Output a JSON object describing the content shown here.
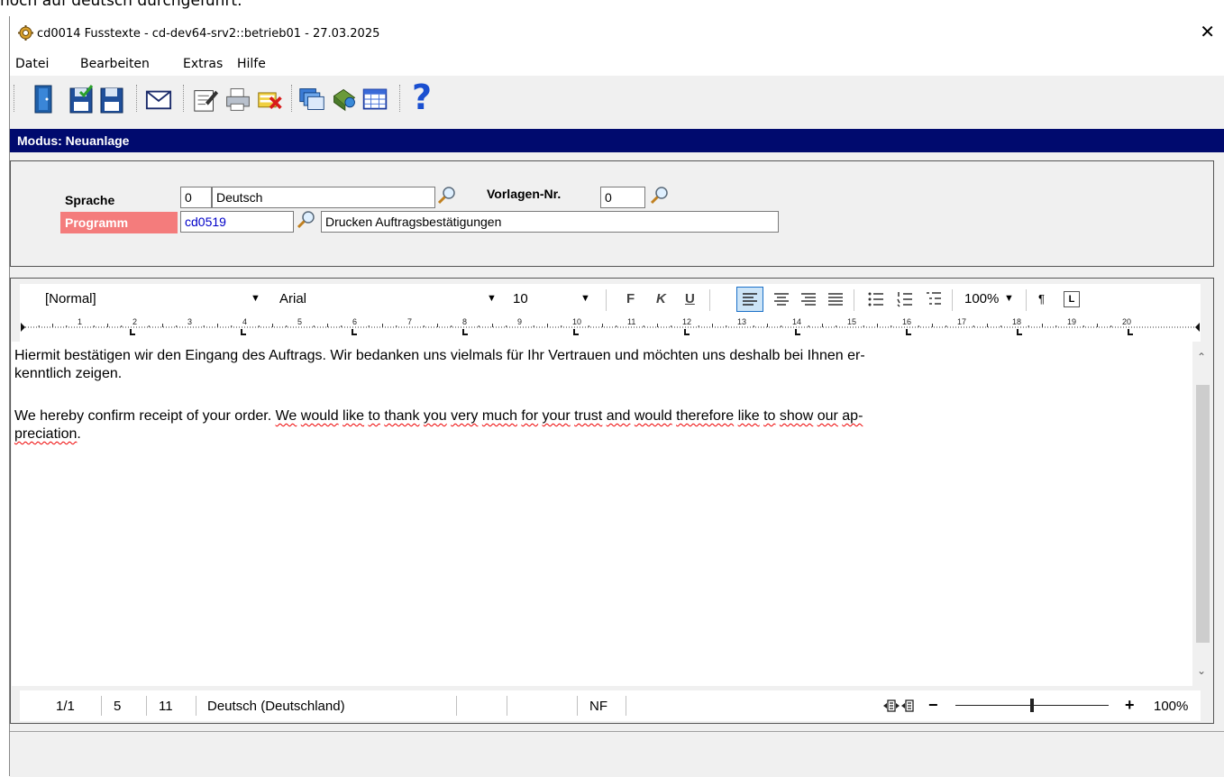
{
  "top_strip_text": "noch auf deutsch durchgeführt.",
  "window": {
    "title": "cd0014 Fusstexte - cd-dev64-srv2::betrieb01 - 27.03.2025",
    "close_symbol": "✕",
    "app_icon": "gear-icon"
  },
  "menu": [
    "Datei",
    "Bearbeiten",
    "Extras",
    "Hilfe"
  ],
  "toolbar": {
    "icons": [
      "exit-door-icon",
      "save-check-icon",
      "save-icon",
      "envelope-icon",
      "edit-form-icon",
      "printer-icon",
      "delete-red-x-icon",
      "windows-stack-icon",
      "bookmark-icon",
      "grid-table-icon",
      "help-question-icon"
    ],
    "help_symbol": "?"
  },
  "mode": "Modus: Neuanlage",
  "form": {
    "sprache_label": "Sprache",
    "sprache_code": "0",
    "sprache_name": "Deutsch",
    "vorlagen_label": "Vorlagen-Nr.",
    "vorlagen_value": "0",
    "programm_label": "Programm",
    "programm_value": "cd0519",
    "programm_desc": "Drucken Auftragsbestätigungen",
    "programm_label_bg": "#f47c7c"
  },
  "format_toolbar": {
    "style": "[Normal]",
    "font": "Arial",
    "size": "10",
    "bold": "F",
    "italic": "K",
    "underline": "U",
    "zoom": "100%",
    "pilcrow": "¶",
    "tab_symbol": "L"
  },
  "ruler": {
    "numbers": [
      "1",
      "2",
      "3",
      "4",
      "5",
      "6",
      "7",
      "8",
      "9",
      "10",
      "11",
      "12",
      "13",
      "14",
      "15",
      "16",
      "17",
      "18",
      "19",
      "20"
    ]
  },
  "document": {
    "p1_line1": "Hiermit bestätigen wir den Eingang des Auftrags. Wir bedanken uns vielmals für Ihr Vertrauen und möchten uns deshalb bei Ihnen er-",
    "p1_line2": "kenntlich zeigen.",
    "p2_a": "We hereby confirm receipt of your order. ",
    "p2_words": [
      "We",
      "would",
      "like",
      "to",
      "thank",
      "you",
      "very",
      "much",
      "for",
      "your",
      "trust",
      "and",
      "would",
      "therefore",
      "like",
      "to",
      "show",
      "our",
      "ap-"
    ],
    "p2_line2": "preciation",
    "p2_end": "."
  },
  "statusbar": {
    "page": "1/1",
    "line": "5",
    "col": "11",
    "language": "Deutsch (Deutschland)",
    "mode": "NF",
    "zoom_minus": "−",
    "zoom_plus": "+",
    "zoom": "100%",
    "zoom_level": 0.5
  }
}
